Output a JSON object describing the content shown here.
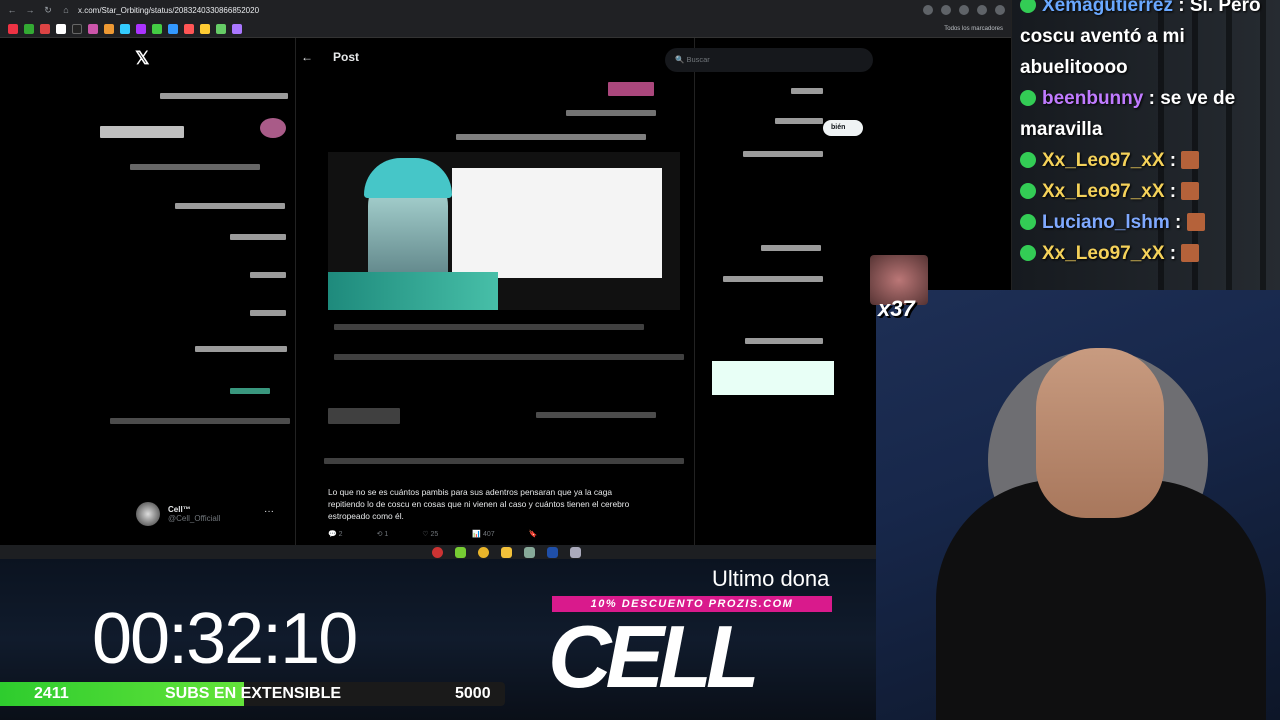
{
  "browser": {
    "url": "x.com/Star_Orbiting/status/2083240330866852020",
    "bookmarks_label": "Todos los marcadores"
  },
  "x_page": {
    "logo": "𝕏",
    "back": "←",
    "title": "Post",
    "search_placeholder": "Buscar",
    "follow_label": "bién",
    "profile": {
      "name": "Cell™",
      "handle": "@Cell_Officiall",
      "more": "···"
    },
    "reply_text": "Lo que no se es cuántos pambis para sus adentros pensaran que ya la caga repitiendo lo de coscu en cosas que ni vienen al caso y cuántos tienen el cerebro estropeado como él.",
    "actions": {
      "replies": "2",
      "reposts": "1",
      "likes": "25",
      "views": "407"
    }
  },
  "chat": {
    "messages": [
      {
        "user": "Xemagutierrez",
        "user_color": "#6aa8ff",
        "text": "Sí. Pero coscu aventó a mi abuelitoooo"
      },
      {
        "user": "beenbunny",
        "user_color": "#c07bff",
        "text": "se ve de maravilla"
      },
      {
        "user": "Xx_Leo97_xX",
        "user_color": "#f5d25a",
        "text": ""
      },
      {
        "user": "Xx_Leo97_xX",
        "user_color": "#f5d25a",
        "text": ""
      },
      {
        "user": "Luciano_lshm",
        "user_color": "#7fa9ff",
        "text": ""
      },
      {
        "user": "Xx_Leo97_xX",
        "user_color": "#f5d25a",
        "text": ""
      }
    ]
  },
  "overlay": {
    "emote_multiplier": "x37",
    "timer": "00:32:10",
    "subs_current": "2411",
    "subs_label": "SUBS EN EXTENSIBLE",
    "subs_goal": "5000",
    "subs_progress": 0.4822,
    "last_donation": "Ultimo dona",
    "promo": "10% DESCUENTO PROZIS.COM",
    "logo_text": "CELL"
  }
}
